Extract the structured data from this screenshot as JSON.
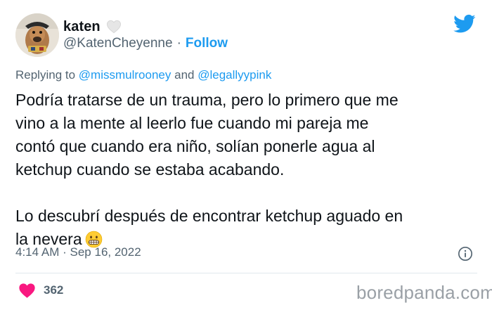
{
  "header": {
    "display_name": "katen",
    "handle": "@KatenCheyenne",
    "separator": "·",
    "follow_label": "Follow"
  },
  "reply": {
    "prefix": "Replying to",
    "mention_1": "@missmulrooney",
    "joiner": "and",
    "mention_2": "@legallyypink"
  },
  "tweet": {
    "lines": [
      "Podría tratarse de un trauma, pero lo primero que me",
      "vino a la mente al leerlo fue cuando mi pareja me",
      "contó que cuando era niño, solían ponerle agua al",
      "ketchup cuando se estaba acabando.",
      "Lo descubrí después de encontrar ketchup aguado en",
      "la nevera"
    ]
  },
  "meta": {
    "time": "4:14 AM",
    "separator": "·",
    "date": "Sep 16, 2022"
  },
  "engagement": {
    "like_count": "362"
  },
  "watermark": "boredpanda.com",
  "colors": {
    "accent": "#1d9bf0",
    "like": "#f91880",
    "secondary_text": "#536471"
  },
  "icons": [
    "white-heart-icon",
    "twitter-logo-icon",
    "grimacing-face-emoji",
    "info-icon",
    "like-heart-icon"
  ]
}
